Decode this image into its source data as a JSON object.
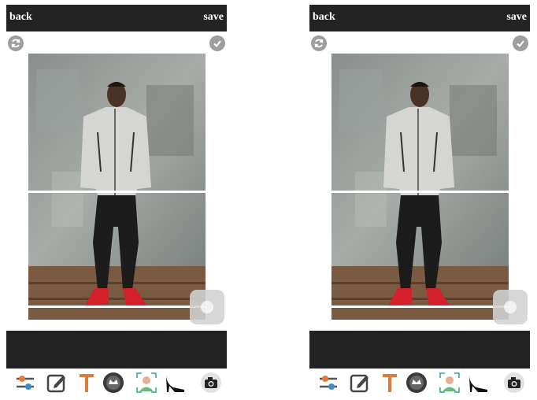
{
  "panels": [
    {
      "back_label": "back",
      "save_label": "save"
    },
    {
      "back_label": "back",
      "save_label": "save"
    }
  ],
  "icons": {
    "rotate": "rotate-icon",
    "confirm": "check-icon",
    "toolbar": [
      "adjust-icon",
      "edit-icon",
      "text-icon",
      "badge-icon",
      "face-frame-icon",
      "heel-icon",
      "camera-icon"
    ]
  },
  "colors": {
    "bar": "#232323",
    "divider": "#ffffff",
    "text_tool": "#e07a3a",
    "sneaker": "#d3202a"
  }
}
